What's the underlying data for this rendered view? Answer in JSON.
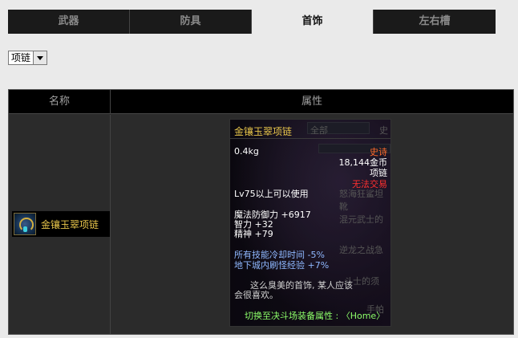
{
  "tabs": [
    {
      "label": "武器",
      "active": false
    },
    {
      "label": "防具",
      "active": false
    },
    {
      "label": "首饰",
      "active": true
    },
    {
      "label": "左右槽",
      "active": false
    }
  ],
  "filter": {
    "selected": "项链"
  },
  "table": {
    "headers": {
      "name": "名称",
      "attr": "属性"
    },
    "item": {
      "name": "金镶玉翠项链"
    }
  },
  "tooltip": {
    "title": "金镶玉翠项链",
    "weight": "0.4kg",
    "rarity": "史诗",
    "price": "18,144金币",
    "type": "项链",
    "trade": "无法交易",
    "level_req": "Lv75以上可以使用",
    "stats": [
      "魔法防御力 +6917",
      "智力 +32",
      "精神 +79"
    ],
    "skills": [
      "所有技能冷却时间 -5%",
      "地下城内刷怪经验 +7%"
    ],
    "desc_line1": "这么臭美的首饰, 某人应该",
    "desc_line2": "会很喜欢。",
    "pvp": "切换至决斗场装备属性 : 〈Home〉",
    "ghost": {
      "all": "全部",
      "rare": "史",
      "row1": "怒海狂鲨坦靴",
      "row2": "混元武士的",
      "row3": "逆龙之战急",
      "row4": "斗士的须",
      "row5": "手帕"
    }
  },
  "colors": {
    "title": "#e6c44a",
    "rarity": "#ff6a2a",
    "trade": "#ff3030",
    "skill": "#8fb8ff",
    "pvp": "#8dff6a"
  }
}
